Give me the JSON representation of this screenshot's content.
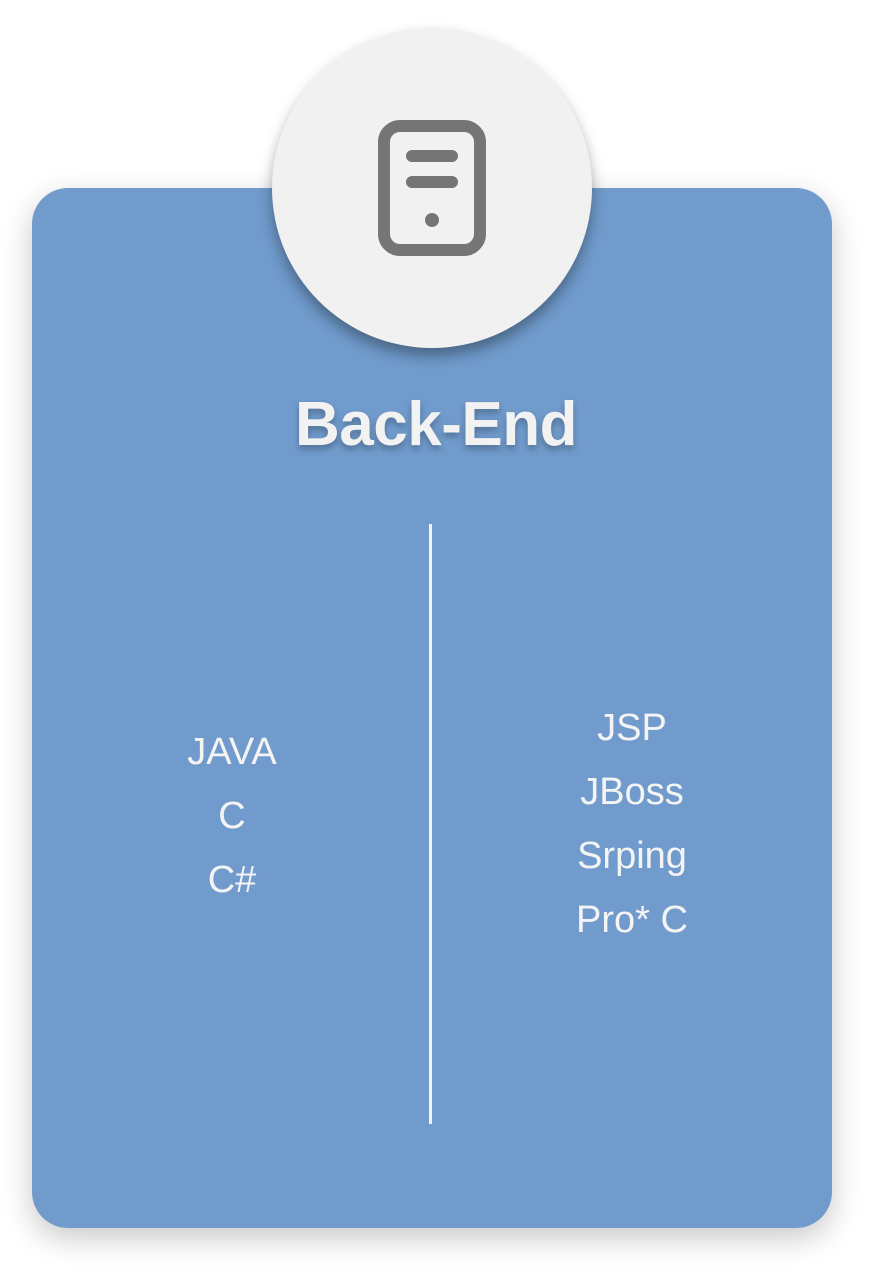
{
  "colors": {
    "card_background": "#709bcc",
    "badge_background": "#f1f1f1",
    "icon_color": "#757575",
    "text_color": "#f4f4f4"
  },
  "badge": {
    "icon": "server-icon"
  },
  "card": {
    "title": "Back-End",
    "languages": [
      "JAVA",
      "C",
      "C#"
    ],
    "frameworks": [
      "JSP",
      "JBoss",
      "Srping",
      "Pro* C"
    ]
  }
}
